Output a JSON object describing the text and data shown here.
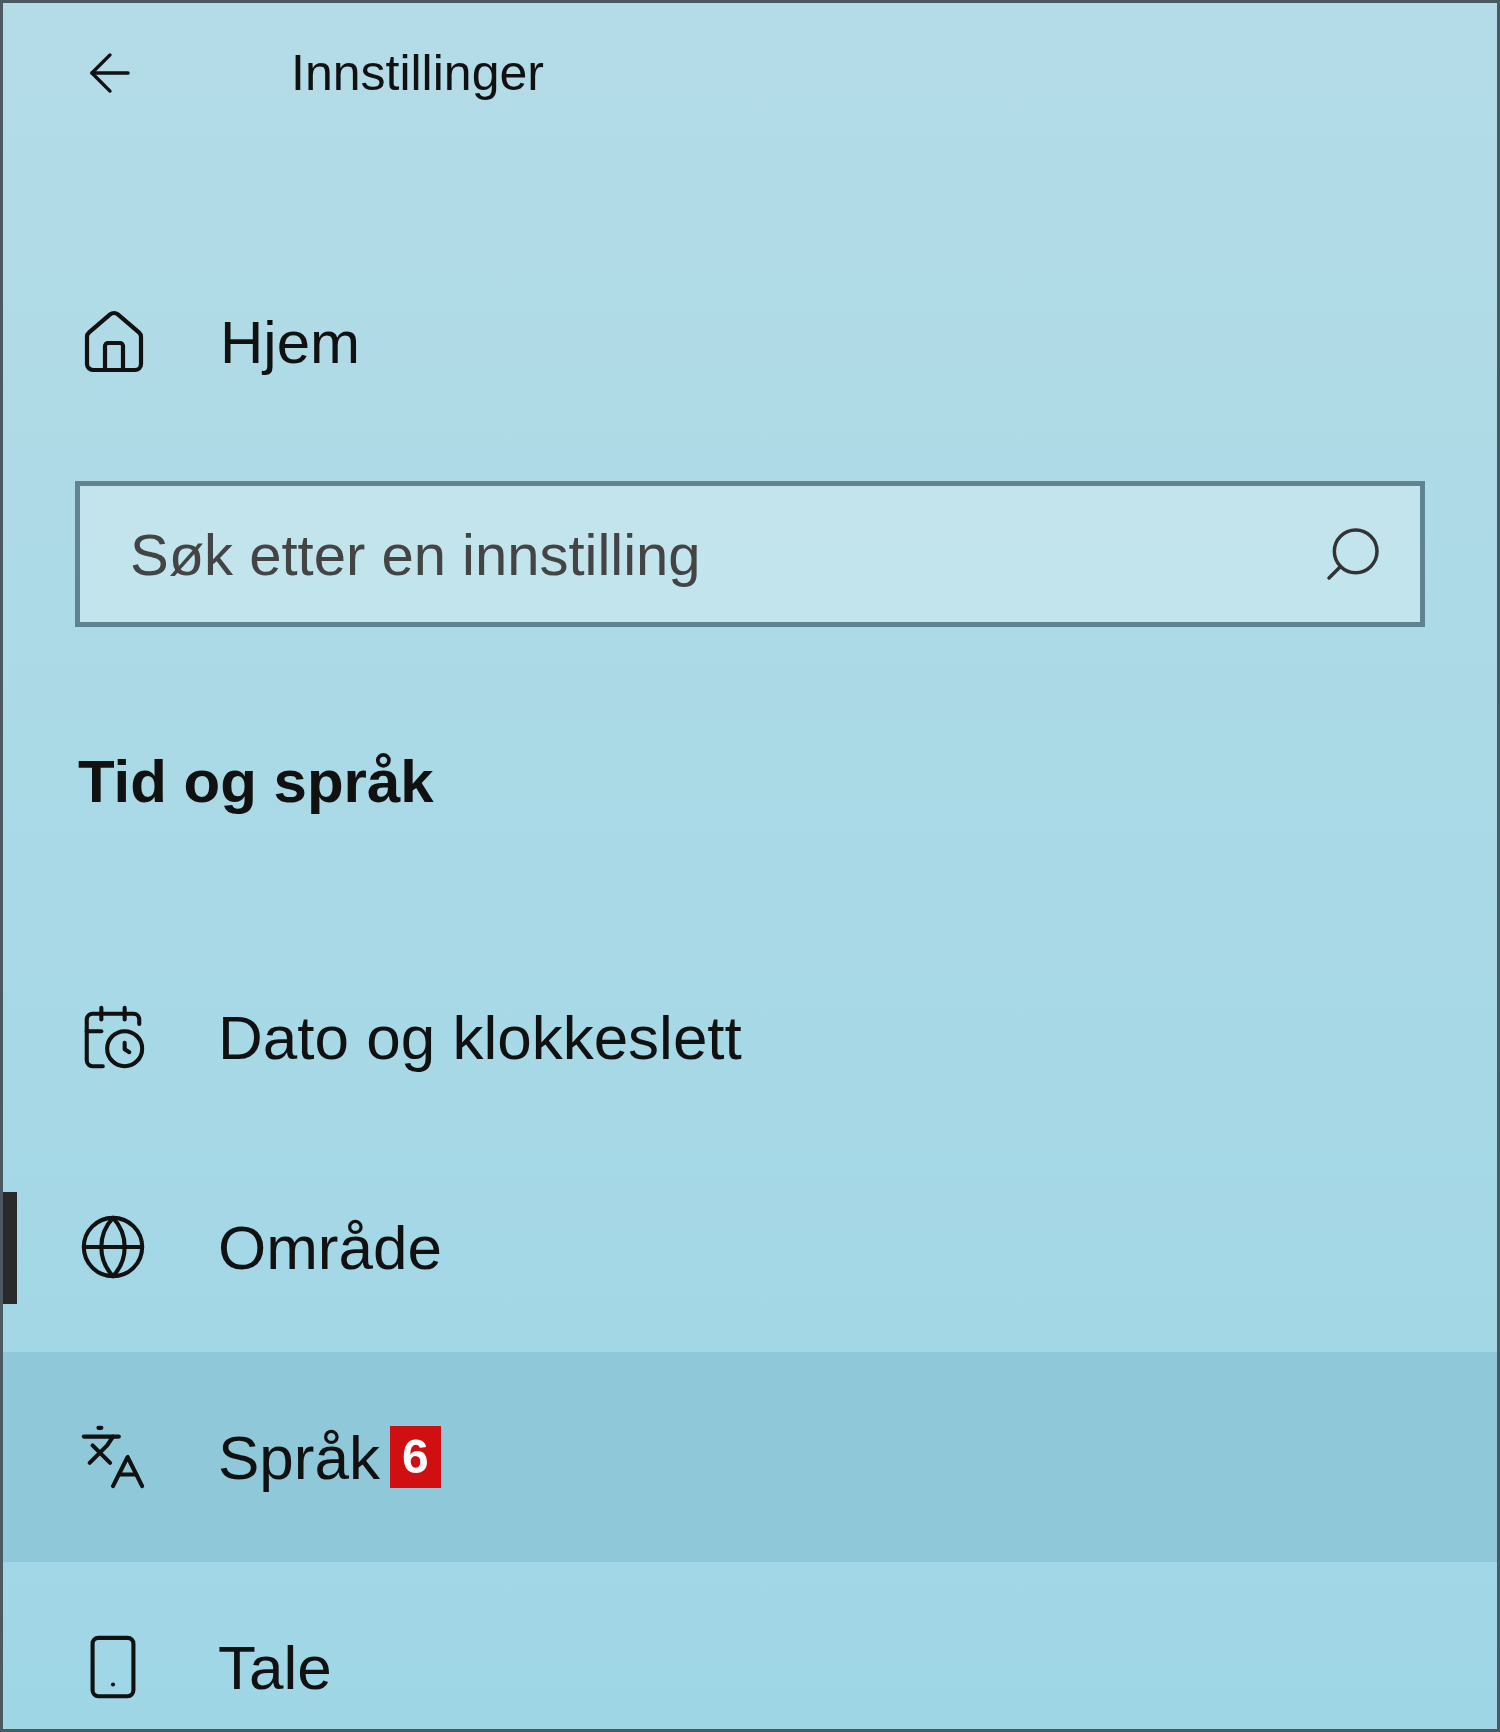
{
  "window": {
    "title": "Innstillinger"
  },
  "home": {
    "label": "Hjem"
  },
  "search": {
    "placeholder": "Søk etter en innstilling"
  },
  "section": {
    "title": "Tid og språk"
  },
  "items": [
    {
      "label": "Dato og klokkeslett",
      "selected": false,
      "hovered": false
    },
    {
      "label": "Område",
      "selected": true,
      "hovered": false
    },
    {
      "label": "Språk",
      "selected": false,
      "hovered": true,
      "badge": "6"
    },
    {
      "label": "Tale",
      "selected": false,
      "hovered": false
    }
  ]
}
